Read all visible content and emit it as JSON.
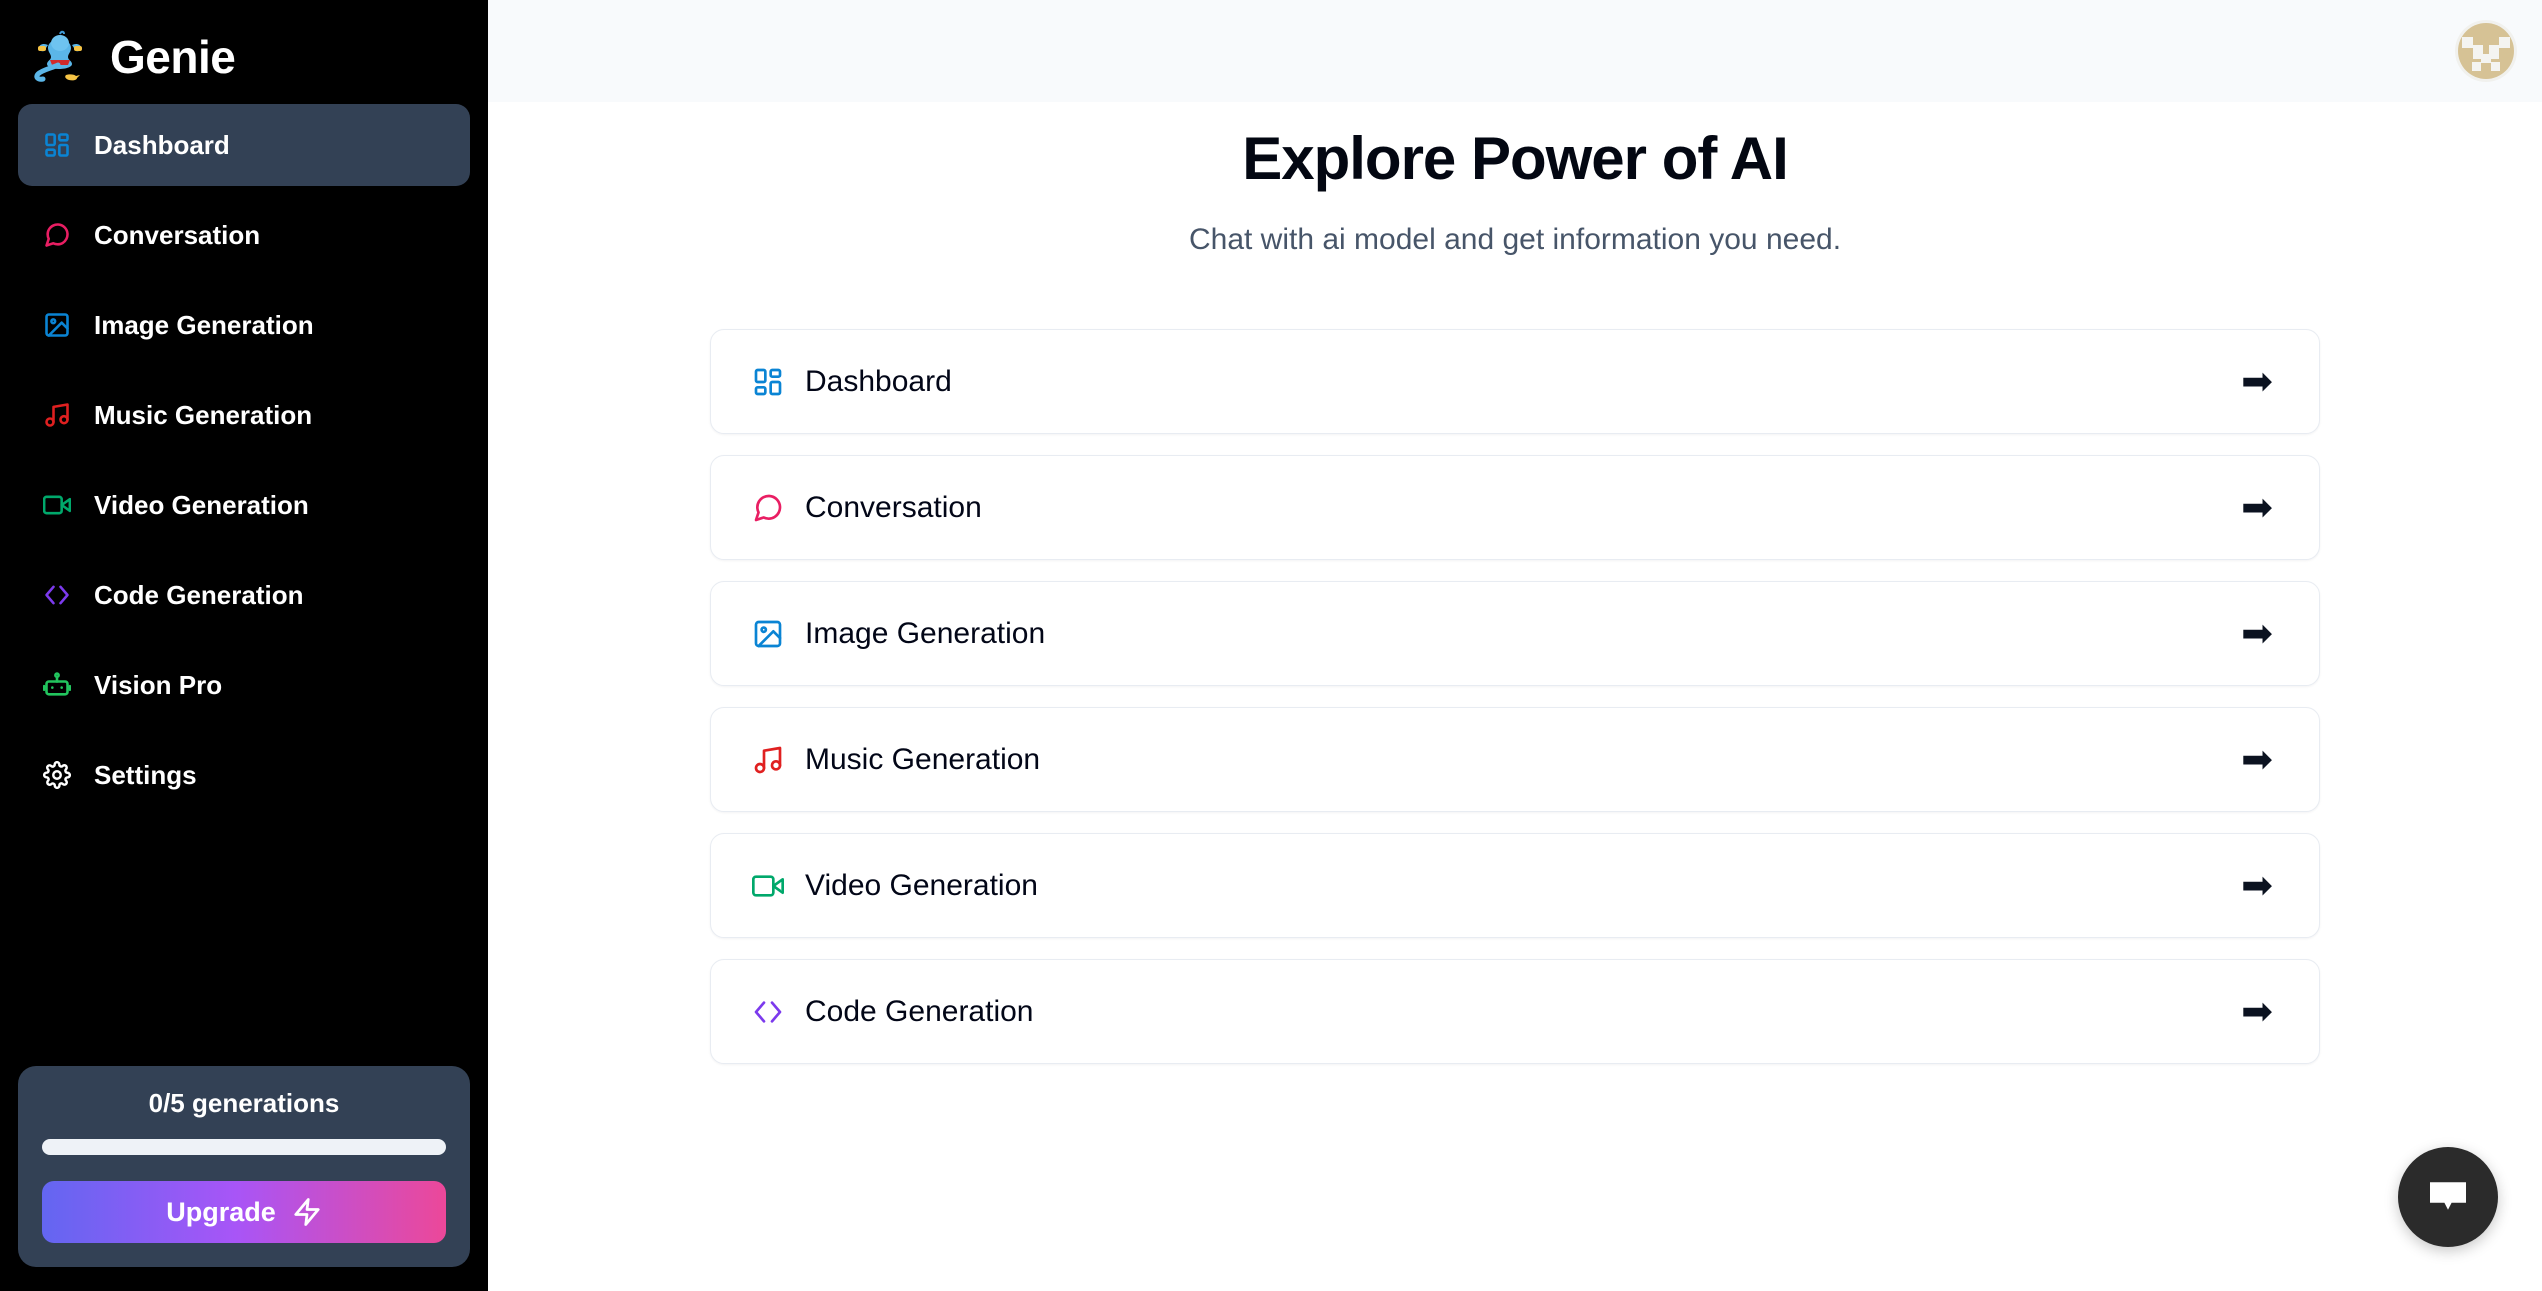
{
  "brand": {
    "name": "Genie",
    "logo_icon": "genie-lamp-logo"
  },
  "sidebar": {
    "items": [
      {
        "label": "Dashboard",
        "icon": "layout-dashboard-icon",
        "color": "#0a84d4",
        "active": true
      },
      {
        "label": "Conversation",
        "icon": "message-square-icon",
        "color": "#e91e63",
        "active": false
      },
      {
        "label": "Image Generation",
        "icon": "image-icon",
        "color": "#0a84d4",
        "active": false
      },
      {
        "label": "Music Generation",
        "icon": "music-note-icon",
        "color": "#e02020",
        "active": false
      },
      {
        "label": "Video Generation",
        "icon": "video-camera-icon",
        "color": "#00a86b",
        "active": false
      },
      {
        "label": "Code Generation",
        "icon": "code-brackets-icon",
        "color": "#7c3aed",
        "active": false
      },
      {
        "label": "Vision Pro",
        "icon": "robot-icon",
        "color": "#22c55e",
        "active": false
      },
      {
        "label": "Settings",
        "icon": "gear-icon",
        "color": "#ffffff",
        "active": false
      }
    ],
    "upgrade_card": {
      "generations_text": "0/5 generations",
      "progress_percent": 0,
      "upgrade_label": "Upgrade",
      "bolt_icon": "zap-icon",
      "gradient_from": "#6366f1",
      "gradient_to": "#ec4899"
    }
  },
  "topbar": {
    "avatar_icon": "user-avatar",
    "avatar_color": "#d6c295"
  },
  "main": {
    "title": "Explore Power of AI",
    "subtitle": "Chat with ai model and get information you need.",
    "cards": [
      {
        "label": "Dashboard",
        "icon": "layout-dashboard-icon",
        "color": "#0a84d4",
        "arrow": "➡"
      },
      {
        "label": "Conversation",
        "icon": "message-square-icon",
        "color": "#e91e63",
        "arrow": "➡"
      },
      {
        "label": "Image Generation",
        "icon": "image-icon",
        "color": "#0a84d4",
        "arrow": "➡"
      },
      {
        "label": "Music Generation",
        "icon": "music-note-icon",
        "color": "#e02020",
        "arrow": "➡"
      },
      {
        "label": "Video Generation",
        "icon": "video-camera-icon",
        "color": "#00a86b",
        "arrow": "➡"
      },
      {
        "label": "Code Generation",
        "icon": "code-brackets-icon",
        "color": "#7c3aed",
        "arrow": "➡"
      }
    ]
  },
  "chat_fab": {
    "icon": "chat-bubble-icon",
    "background": "#2b2b2b"
  }
}
